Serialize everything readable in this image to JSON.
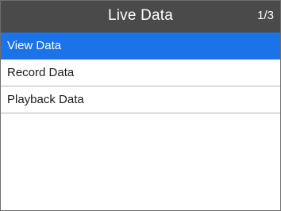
{
  "header": {
    "title": "Live Data",
    "page_indicator": "1/3"
  },
  "menu": {
    "items": [
      {
        "label": "View Data",
        "selected": true
      },
      {
        "label": "Record Data",
        "selected": false
      },
      {
        "label": "Playback Data",
        "selected": false
      }
    ]
  },
  "colors": {
    "title_bar": "#4a4a4a",
    "selection": "#1a73e8",
    "divider": "#b5b5b5"
  }
}
